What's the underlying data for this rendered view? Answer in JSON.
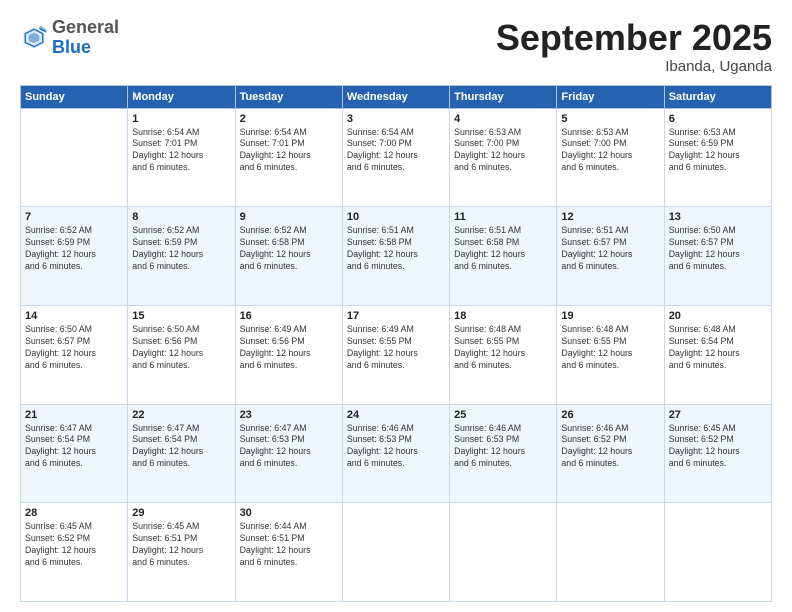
{
  "header": {
    "logo_general": "General",
    "logo_blue": "Blue",
    "month": "September 2025",
    "location": "Ibanda, Uganda"
  },
  "days_of_week": [
    "Sunday",
    "Monday",
    "Tuesday",
    "Wednesday",
    "Thursday",
    "Friday",
    "Saturday"
  ],
  "weeks": [
    [
      {
        "day": "",
        "info": ""
      },
      {
        "day": "1",
        "info": "Sunrise: 6:54 AM\nSunset: 7:01 PM\nDaylight: 12 hours\nand 6 minutes."
      },
      {
        "day": "2",
        "info": "Sunrise: 6:54 AM\nSunset: 7:01 PM\nDaylight: 12 hours\nand 6 minutes."
      },
      {
        "day": "3",
        "info": "Sunrise: 6:54 AM\nSunset: 7:00 PM\nDaylight: 12 hours\nand 6 minutes."
      },
      {
        "day": "4",
        "info": "Sunrise: 6:53 AM\nSunset: 7:00 PM\nDaylight: 12 hours\nand 6 minutes."
      },
      {
        "day": "5",
        "info": "Sunrise: 6:53 AM\nSunset: 7:00 PM\nDaylight: 12 hours\nand 6 minutes."
      },
      {
        "day": "6",
        "info": "Sunrise: 6:53 AM\nSunset: 6:59 PM\nDaylight: 12 hours\nand 6 minutes."
      }
    ],
    [
      {
        "day": "7",
        "info": "Sunrise: 6:52 AM\nSunset: 6:59 PM\nDaylight: 12 hours\nand 6 minutes."
      },
      {
        "day": "8",
        "info": "Sunrise: 6:52 AM\nSunset: 6:59 PM\nDaylight: 12 hours\nand 6 minutes."
      },
      {
        "day": "9",
        "info": "Sunrise: 6:52 AM\nSunset: 6:58 PM\nDaylight: 12 hours\nand 6 minutes."
      },
      {
        "day": "10",
        "info": "Sunrise: 6:51 AM\nSunset: 6:58 PM\nDaylight: 12 hours\nand 6 minutes."
      },
      {
        "day": "11",
        "info": "Sunrise: 6:51 AM\nSunset: 6:58 PM\nDaylight: 12 hours\nand 6 minutes."
      },
      {
        "day": "12",
        "info": "Sunrise: 6:51 AM\nSunset: 6:57 PM\nDaylight: 12 hours\nand 6 minutes."
      },
      {
        "day": "13",
        "info": "Sunrise: 6:50 AM\nSunset: 6:57 PM\nDaylight: 12 hours\nand 6 minutes."
      }
    ],
    [
      {
        "day": "14",
        "info": "Sunrise: 6:50 AM\nSunset: 6:57 PM\nDaylight: 12 hours\nand 6 minutes."
      },
      {
        "day": "15",
        "info": "Sunrise: 6:50 AM\nSunset: 6:56 PM\nDaylight: 12 hours\nand 6 minutes."
      },
      {
        "day": "16",
        "info": "Sunrise: 6:49 AM\nSunset: 6:56 PM\nDaylight: 12 hours\nand 6 minutes."
      },
      {
        "day": "17",
        "info": "Sunrise: 6:49 AM\nSunset: 6:55 PM\nDaylight: 12 hours\nand 6 minutes."
      },
      {
        "day": "18",
        "info": "Sunrise: 6:48 AM\nSunset: 6:55 PM\nDaylight: 12 hours\nand 6 minutes."
      },
      {
        "day": "19",
        "info": "Sunrise: 6:48 AM\nSunset: 6:55 PM\nDaylight: 12 hours\nand 6 minutes."
      },
      {
        "day": "20",
        "info": "Sunrise: 6:48 AM\nSunset: 6:54 PM\nDaylight: 12 hours\nand 6 minutes."
      }
    ],
    [
      {
        "day": "21",
        "info": "Sunrise: 6:47 AM\nSunset: 6:54 PM\nDaylight: 12 hours\nand 6 minutes."
      },
      {
        "day": "22",
        "info": "Sunrise: 6:47 AM\nSunset: 6:54 PM\nDaylight: 12 hours\nand 6 minutes."
      },
      {
        "day": "23",
        "info": "Sunrise: 6:47 AM\nSunset: 6:53 PM\nDaylight: 12 hours\nand 6 minutes."
      },
      {
        "day": "24",
        "info": "Sunrise: 6:46 AM\nSunset: 6:53 PM\nDaylight: 12 hours\nand 6 minutes."
      },
      {
        "day": "25",
        "info": "Sunrise: 6:46 AM\nSunset: 6:53 PM\nDaylight: 12 hours\nand 6 minutes."
      },
      {
        "day": "26",
        "info": "Sunrise: 6:46 AM\nSunset: 6:52 PM\nDaylight: 12 hours\nand 6 minutes."
      },
      {
        "day": "27",
        "info": "Sunrise: 6:45 AM\nSunset: 6:52 PM\nDaylight: 12 hours\nand 6 minutes."
      }
    ],
    [
      {
        "day": "28",
        "info": "Sunrise: 6:45 AM\nSunset: 6:52 PM\nDaylight: 12 hours\nand 6 minutes."
      },
      {
        "day": "29",
        "info": "Sunrise: 6:45 AM\nSunset: 6:51 PM\nDaylight: 12 hours\nand 6 minutes."
      },
      {
        "day": "30",
        "info": "Sunrise: 6:44 AM\nSunset: 6:51 PM\nDaylight: 12 hours\nand 6 minutes."
      },
      {
        "day": "",
        "info": ""
      },
      {
        "day": "",
        "info": ""
      },
      {
        "day": "",
        "info": ""
      },
      {
        "day": "",
        "info": ""
      }
    ]
  ]
}
